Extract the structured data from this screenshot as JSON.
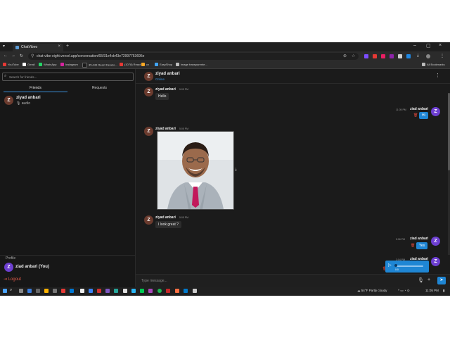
{
  "browser": {
    "tab_title": "ChatVibeo",
    "new_tab": "+",
    "url": "chat-vibe-eight.vercel.app/conversation/65f31e4cb43e72997753695e",
    "bookmarks": [
      {
        "label": "YouTube",
        "color": "#e53935"
      },
      {
        "label": "Gmail",
        "color": "#ffffff"
      },
      {
        "label": "WhatsApp",
        "color": "#25d366"
      },
      {
        "label": "Instagram",
        "color": "#d6249f"
      },
      {
        "label": "35,446 React Develo...",
        "color": "#1a1a1a"
      },
      {
        "label": "(1078) React",
        "color": "#e53935"
      },
      {
        "label": "cv",
        "color": "#f9a825"
      },
      {
        "label": "EasyShop",
        "color": "#42a5f5"
      },
      {
        "label": "image transparente...",
        "color": "#bdbdbd"
      }
    ],
    "all_bookmarks": "All Bookmarks"
  },
  "sidebar": {
    "search_placeholder": "Search for friends...",
    "tabs": [
      {
        "label": "Friends",
        "active": true
      },
      {
        "label": "Requests",
        "active": false
      }
    ],
    "friends": [
      {
        "name": "ziyad anbari",
        "initial": "Z",
        "last_message": "audio"
      }
    ],
    "profile_label": "Profile",
    "profile_name": "ziad anbari (You)",
    "profile_initial": "Z",
    "logout": "Logout"
  },
  "chat": {
    "contact_name": "ziyad anbari",
    "contact_initial": "Z",
    "contact_status": "Online",
    "messages": [
      {
        "from": "ziyad anbari",
        "time": "5:05 PM",
        "text": "Hello",
        "incoming": true
      },
      {
        "from": "ziad anbari",
        "time": "11:05 PM",
        "text": "Hi",
        "incoming": false
      },
      {
        "from": "ziyad anbari",
        "time": "5:05 PM",
        "text": "",
        "incoming": true,
        "type": "image"
      },
      {
        "from": "ziyad anbari",
        "time": "5:05 PM",
        "text": "I look great ?",
        "incoming": true
      },
      {
        "from": "ziad anbari",
        "time": "5:06 PM",
        "text": "Yes",
        "incoming": false
      },
      {
        "from": "ziad anbari",
        "time": "3:04 PM",
        "text": "",
        "incoming": false,
        "type": "audio",
        "duration": "0:0"
      }
    ],
    "composer_placeholder": "Type message..."
  },
  "taskbar": {
    "weather": "54°F  Partly cloudy",
    "time": "11:05 PM"
  },
  "colors": {
    "accent": "#1f86d4",
    "danger": "#e05a4a",
    "online": "#3b8fd9"
  }
}
